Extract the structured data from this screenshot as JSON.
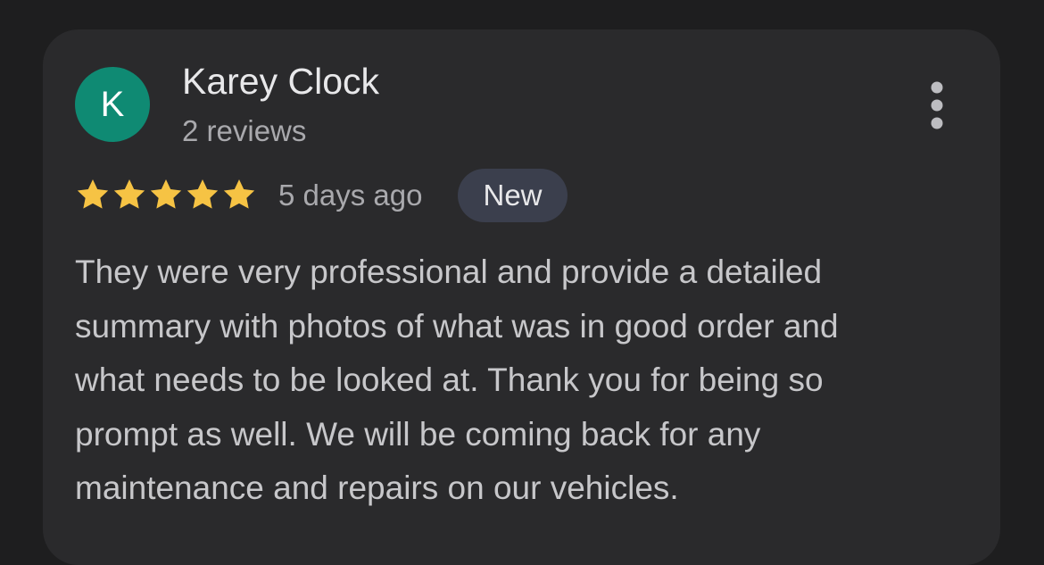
{
  "review": {
    "avatar_initial": "K",
    "reviewer_name": "Karey Clock",
    "review_count": "2 reviews",
    "rating": 5,
    "max_rating": 5,
    "time_ago": "5 days ago",
    "badge": "New",
    "text_lines": [
      "They were very professional and provide a detailed",
      "summary with photos of what was in good order and",
      "what needs to be looked at. Thank you for being so",
      "prompt as well. We will be coming back for any",
      "maintenance and repairs on our vehicles."
    ]
  },
  "icons": {
    "more": "more-vert-icon",
    "star": "star-icon"
  },
  "colors": {
    "background": "#1e1e1f",
    "card": "#2a2a2c",
    "avatar": "#0f8a73",
    "star": "#f6c344",
    "badge_bg": "#3b3f4d"
  }
}
